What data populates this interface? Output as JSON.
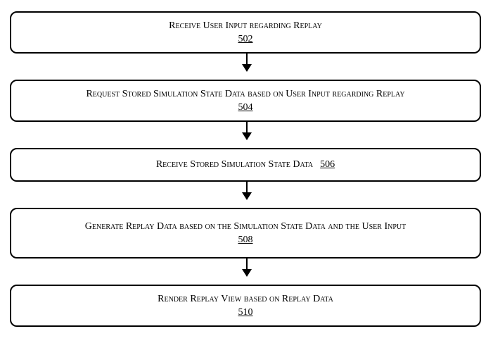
{
  "chart_data": {
    "type": "flowchart",
    "direction": "top-down",
    "nodes": [
      {
        "id": "502",
        "label": "Receive User Input regarding Replay",
        "number": "502"
      },
      {
        "id": "504",
        "label": "Request Stored Simulation State Data based on User Input regarding Replay",
        "number": "504"
      },
      {
        "id": "506",
        "label": "Receive Stored Simulation State Data",
        "number": "506"
      },
      {
        "id": "508",
        "label": "Generate Replay Data based on the Simulation State Data and the User Input",
        "number": "508"
      },
      {
        "id": "510",
        "label": "Render Replay View based on Replay Data",
        "number": "510"
      }
    ],
    "edges": [
      {
        "from": "502",
        "to": "504"
      },
      {
        "from": "504",
        "to": "506"
      },
      {
        "from": "506",
        "to": "508"
      },
      {
        "from": "508",
        "to": "510"
      }
    ]
  },
  "steps": {
    "s502": {
      "label": "Receive User Input regarding Replay",
      "number": "502"
    },
    "s504": {
      "label": "Request Stored Simulation State Data based on User Input regarding Replay",
      "number": "504"
    },
    "s506": {
      "label": "Receive Stored Simulation State Data",
      "number": "506"
    },
    "s508": {
      "label": "Generate Replay Data based on the Simulation State Data and the User Input",
      "number": "508"
    },
    "s510": {
      "label": "Render Replay View based on Replay Data",
      "number": "510"
    }
  }
}
